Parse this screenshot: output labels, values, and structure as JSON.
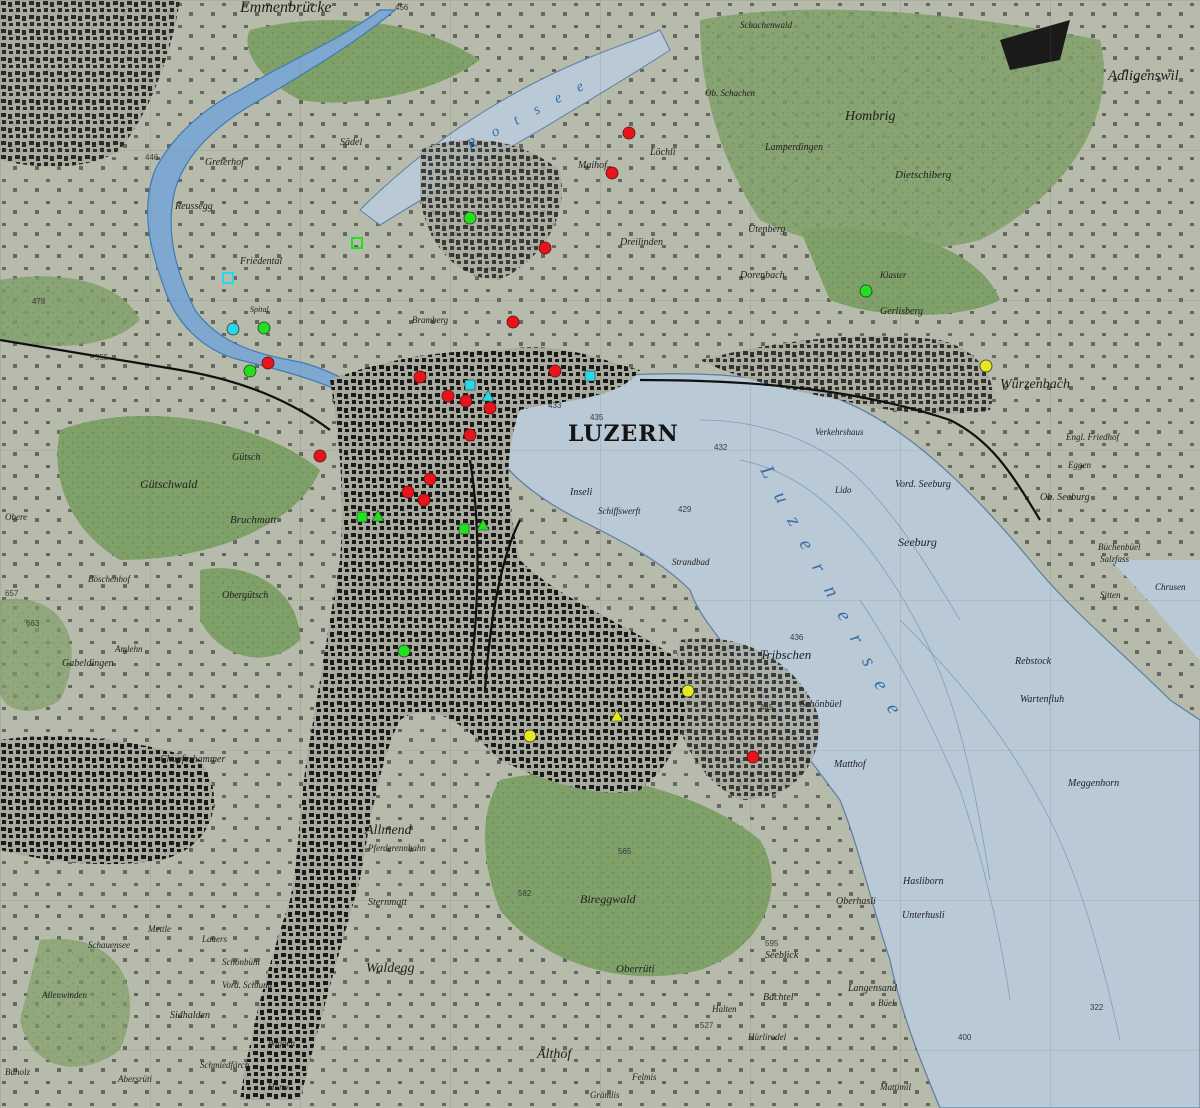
{
  "map": {
    "city_label": "LUZERN",
    "lake_labels": [
      "Rotsee",
      "Luzernersee"
    ],
    "place_labels": [
      "Emmenbrücke",
      "Adligenswil",
      "Hombrig",
      "Dietschiberg",
      "Greterhof",
      "Reussegg",
      "Friedental",
      "Sädel",
      "Löchli",
      "Maihof",
      "Dreilinden",
      "Utenberg",
      "Dorenbach",
      "Lamperdingen",
      "Ob. Schachen",
      "Schachenwald",
      "Klaster",
      "Gerlisberg",
      "Würzenbach",
      "Verkehrshaus",
      "Lido",
      "Vord. Seeburg",
      "Ob. Seeburg",
      "Seeburg",
      "Inseli",
      "Schiffswerft",
      "Strandbad",
      "Tribschen",
      "Schönbüel",
      "Matthof",
      "Rebstock",
      "Wartenfluh",
      "Meggenhorn",
      "Hasliborn",
      "Unterhusli",
      "Oberhasli",
      "Seeblick",
      "Langensand",
      "Büel",
      "Bachtel",
      "Oberrüti",
      "Allmend",
      "Pferderennbahn",
      "Sternmatt",
      "Waldegg",
      "Althof",
      "Bireggwald",
      "Bruchmatt",
      "Gütsch",
      "Gütschwald",
      "Obergütsch",
      "Gabeldingen",
      "Chupferhammer",
      "Amlehn",
      "Böschenhof",
      "Obere",
      "Sidhalden",
      "Schönbühl",
      "Horw",
      "Wiggen",
      "Vord. Schlund",
      "Lauers",
      "Mettle",
      "Schauensee",
      "Allenwinden",
      "Buholz",
      "Abersrüti",
      "Schmiedfärch",
      "Spital",
      "Bramberg",
      "Salzfass",
      "Sitten",
      "Chrusen",
      "Büchenbüel",
      "Eggen",
      "Engl. Friedhof",
      "Halten",
      "Hürlirodel",
      "Felmis",
      "Grämlis",
      "Mattimil"
    ],
    "elevation_labels": [
      "435",
      "433",
      "436",
      "432",
      "429",
      "445",
      "565",
      "582",
      "595",
      "527",
      "322",
      "400",
      "446",
      "456",
      "478",
      "555",
      "657",
      "663"
    ],
    "marker_legend": {
      "red": "#e8141c",
      "green": "#22e01e",
      "yellow": "#e9e81c",
      "cyan": "#29d8e8"
    },
    "markers": [
      {
        "color": "red",
        "shape": "circle"
      },
      {
        "color": "red",
        "shape": "circle"
      },
      {
        "color": "red",
        "shape": "circle"
      },
      {
        "color": "red",
        "shape": "circle"
      },
      {
        "color": "red",
        "shape": "circle"
      },
      {
        "color": "red",
        "shape": "circle"
      },
      {
        "color": "red",
        "shape": "circle"
      },
      {
        "color": "red",
        "shape": "circle"
      },
      {
        "color": "red",
        "shape": "circle"
      },
      {
        "color": "red",
        "shape": "circle"
      },
      {
        "color": "red",
        "shape": "circle"
      },
      {
        "color": "red",
        "shape": "circle"
      },
      {
        "color": "red",
        "shape": "circle"
      },
      {
        "color": "red",
        "shape": "circle"
      },
      {
        "color": "red",
        "shape": "circle"
      },
      {
        "color": "red",
        "shape": "circle"
      },
      {
        "color": "green",
        "shape": "circle"
      },
      {
        "color": "green",
        "shape": "circle"
      },
      {
        "color": "green",
        "shape": "circle"
      },
      {
        "color": "green",
        "shape": "circle"
      },
      {
        "color": "green",
        "shape": "circle"
      },
      {
        "color": "green",
        "shape": "square"
      },
      {
        "color": "green",
        "shape": "triangle"
      },
      {
        "color": "green",
        "shape": "square"
      },
      {
        "color": "green",
        "shape": "triangle"
      },
      {
        "color": "green",
        "shape": "square-outline"
      },
      {
        "color": "yellow",
        "shape": "circle"
      },
      {
        "color": "yellow",
        "shape": "circle"
      },
      {
        "color": "yellow",
        "shape": "circle"
      },
      {
        "color": "yellow",
        "shape": "triangle"
      },
      {
        "color": "cyan",
        "shape": "circle"
      },
      {
        "color": "cyan",
        "shape": "square"
      },
      {
        "color": "cyan",
        "shape": "triangle"
      },
      {
        "color": "cyan",
        "shape": "square"
      },
      {
        "color": "cyan",
        "shape": "square-outline"
      }
    ]
  }
}
